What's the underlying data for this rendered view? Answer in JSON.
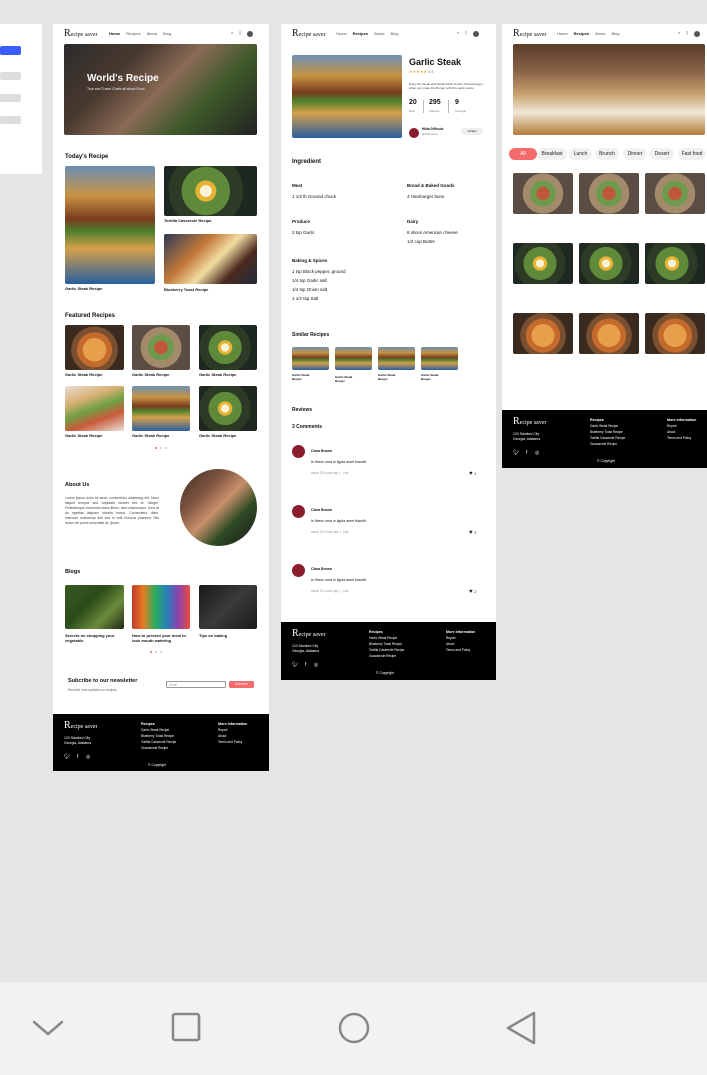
{
  "nav": {
    "logo_initial": "R",
    "logo_text": "ecipe saver",
    "home": "Home",
    "recipes": "Recipes",
    "about": "About",
    "blog": "Blog"
  },
  "home": {
    "hero_title": "World's Recipe",
    "hero_sub": "Tour and Travel Chefs all about Food",
    "todays_title": "Today's Recipe",
    "todays": [
      "Garlic Steak Recipe",
      "Tortilla Casserole Recipe",
      "Blueberry Toast Recipe"
    ],
    "featured_title": "Featured Recipes",
    "featured": [
      "Garlic Steak Recipe",
      "Garlic Steak Recipe",
      "Garlic Steak Recipe",
      "Garlic Steak Recipe",
      "Garlic Steak Recipe",
      "Garlic Steak Recipe"
    ],
    "about_title": "About Us",
    "about_text": "Lorem ipsum dolor sit amet, consectetur adipiscing elit. Nunc aliquet tempus sed vulputate laoreet nec et. Integer. Pellentesque commodo netus libero, sem ullamcorper. Urna at do egestas aliquam lobortis lectus. Consectetur diam. Interdum maecenas sed sed in velit rhoncus pharetra. Nisi lectus vel purus venenatis at. Quam.",
    "blogs_title": "Blogs",
    "blogs": [
      "Secrets on chopping your vegetable",
      "How to present your meal to look mouth watering",
      "Tips on baking"
    ],
    "newsletter_title": "Subcribe to our newsletter",
    "newsletter_sub": "Receive new updates on recipes",
    "email_placeholder": "Email",
    "subscribe": "Subcribe"
  },
  "detail": {
    "title": "Garlic Steak",
    "rating_count": "4.8",
    "desc": "Enjoy the Steak and Steak Garlic Tender Cheeseburger when you make this Burger with this quick recipe",
    "stats": [
      {
        "value": "20",
        "label": "Mins"
      },
      {
        "value": "295",
        "label": "Calories"
      },
      {
        "value": "9",
        "label": "Servings"
      }
    ],
    "author_name": "Hilda Difficulo",
    "author_role": "@chefmums",
    "follow": "Follow",
    "ingredient_title": "Ingredient",
    "groups": [
      {
        "name": "Meat",
        "items": [
          "1 1/2 lb Ground chuck"
        ]
      },
      {
        "name": "Bread & Baked Goods",
        "items": [
          "4 Hamburger buns"
        ]
      },
      {
        "name": "Produce",
        "items": [
          "2 tsp Garlic"
        ]
      },
      {
        "name": "Dairy",
        "items": [
          "8 slices American cheese",
          "1/2 cup Butter"
        ]
      },
      {
        "name": "Baking & Spices",
        "items": [
          "1 tsp Black pepper, ground",
          "1/4 tsp Garlic salt",
          "1/4 tsp Onion salt",
          "1 1/2 tsp Salt"
        ]
      }
    ],
    "similar_title": "Similar Recipes",
    "similar": [
      "Garlic Steak Burger",
      "Garlic Steak Burger",
      "Garlic Steak Burger",
      "Garlic Steak Burger"
    ],
    "reviews_title": "Reviews",
    "comments_count": "3 Comments",
    "comments": [
      {
        "name": "Clara Brown",
        "text": "In libero urna in ligula amet blandit.",
        "meta": "about 20 hours ago",
        "like": "Like",
        "hearts": "2"
      },
      {
        "name": "Clara Brown",
        "text": "In libero urna in ligula amet blandit.",
        "meta": "about 20 hours ago",
        "like": "Like",
        "hearts": "2"
      },
      {
        "name": "Clara Brown",
        "text": "In libero urna in ligula amet blandit.",
        "meta": "about 20 hours ago",
        "like": "Like",
        "hearts": "2"
      }
    ]
  },
  "recipes_page": {
    "filters": [
      "All",
      "Breakfast",
      "Lunch",
      "Brunch",
      "Dinner",
      "Desert",
      "Fast food"
    ]
  },
  "footer": {
    "address_line1": "123 Stanford City",
    "address_line2": "Georgia, Alabama",
    "recipes_title": "Recipes",
    "recipes_links": [
      "Garlic Steak Recipe",
      "Blueberry Toast Recipe",
      "Tortilla Casserole Recipe",
      "Guacamole Recipe"
    ],
    "info_title": "More Information",
    "info_links": [
      "Report",
      "About",
      "Terms and Policy"
    ],
    "copyright": "Copyright"
  },
  "colors": {
    "accent": "#f36b6b",
    "blue": "#3b5cff",
    "footer_bg": "#000000"
  }
}
